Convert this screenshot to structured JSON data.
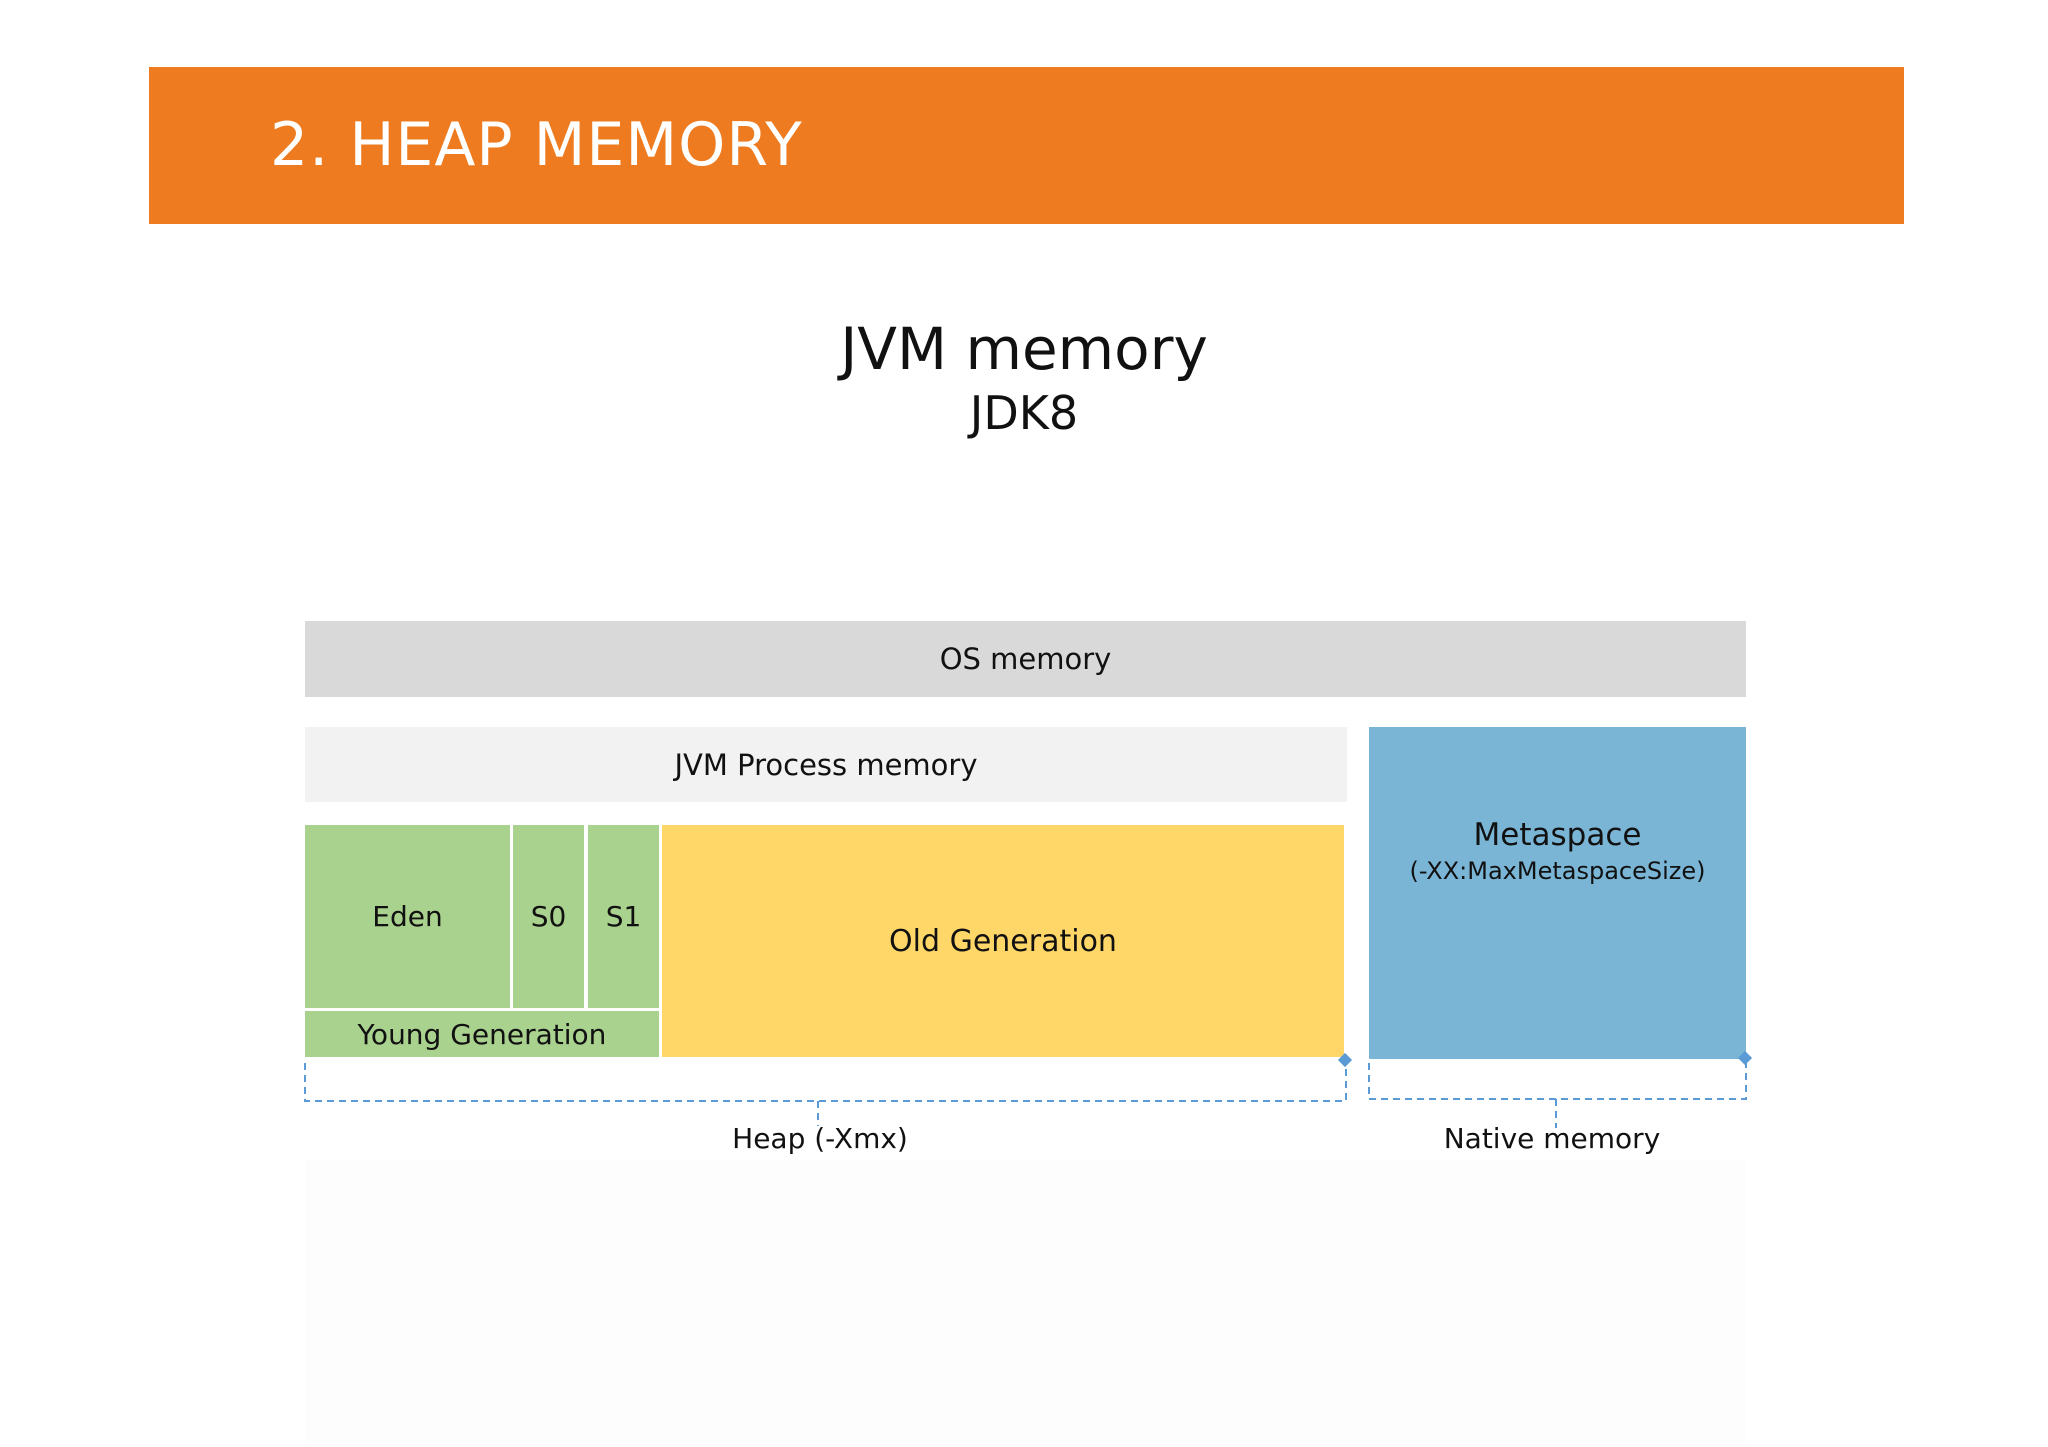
{
  "header": {
    "title": "2. HEAP MEMORY",
    "color": "#ee7b1f"
  },
  "diagram": {
    "title": "JVM memory",
    "subtitle": "JDK8",
    "os_memory": "OS memory",
    "jvm_process_memory": "JVM Process memory",
    "eden": "Eden",
    "s0": "S0",
    "s1": "S1",
    "young_generation": "Young Generation",
    "old_generation": "Old Generation",
    "metaspace": {
      "title": "Metaspace",
      "flag": "(-XX:MaxMetaspaceSize)"
    },
    "heap_label": "Heap (-Xmx)",
    "native_label": "Native memory",
    "colors": {
      "os_memory": "#d9d9d9",
      "jvm_process": "#f2f2f2",
      "young": "#aad28f",
      "old": "#fed768",
      "metaspace": "#7ab5d6",
      "bracket": "#5b9bd5"
    }
  }
}
